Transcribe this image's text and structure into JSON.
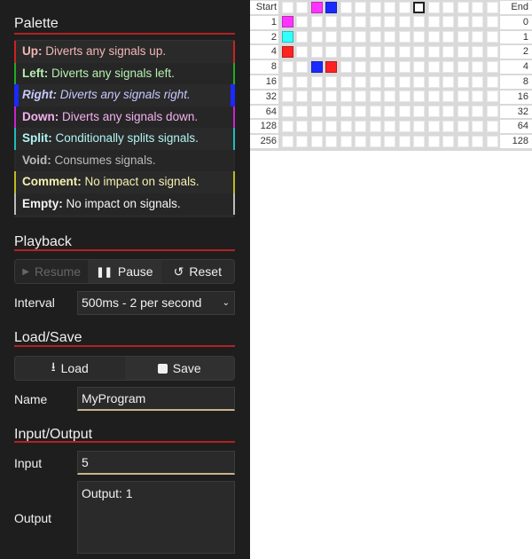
{
  "palette": {
    "title": "Palette",
    "items": [
      {
        "name": "Up",
        "desc": "Diverts any signals up.",
        "text_color": "#f4b6b6",
        "bar_color": "#cc2222",
        "selected": false
      },
      {
        "name": "Left",
        "desc": "Diverts any signals left.",
        "text_color": "#b6f0b0",
        "bar_color": "#22aa22",
        "selected": false
      },
      {
        "name": "Right",
        "desc": "Diverts any signals right.",
        "text_color": "#c8c8ff",
        "bar_color": "#1a2aff",
        "selected": true
      },
      {
        "name": "Down",
        "desc": "Diverts any signals down.",
        "text_color": "#f4b0f0",
        "bar_color": "#cc22cc",
        "selected": false
      },
      {
        "name": "Split",
        "desc": "Conditionally splits signals.",
        "text_color": "#b0f4f4",
        "bar_color": "#22bbbb",
        "selected": false
      },
      {
        "name": "Void",
        "desc": "Consumes signals.",
        "text_color": "#bbbbbb",
        "bar_color": "#2a2a2a",
        "selected": false
      },
      {
        "name": "Comment",
        "desc": "No impact on signals.",
        "text_color": "#f4f0b0",
        "bar_color": "#bbbb22",
        "selected": false
      },
      {
        "name": "Empty",
        "desc": "No impact on signals.",
        "text_color": "#f4f4f4",
        "bar_color": "#bbbbbb",
        "selected": false
      }
    ]
  },
  "playback": {
    "title": "Playback",
    "resume_label": "Resume",
    "pause_label": "Pause",
    "reset_label": "Reset",
    "interval_label": "Interval",
    "interval_value": "500ms - 2 per second"
  },
  "loadsave": {
    "title": "Load/Save",
    "load_label": "Load",
    "save_label": "Save",
    "name_label": "Name",
    "name_value": "MyProgram"
  },
  "io": {
    "title": "Input/Output",
    "input_label": "Input",
    "input_value": "5",
    "output_label": "Output",
    "output_value": "Output: 1"
  },
  "grid": {
    "columns": 15,
    "left_labels": [
      "Start",
      "1",
      "2",
      "4",
      "8",
      "16",
      "32",
      "64",
      "128",
      "256"
    ],
    "right_labels": [
      "End",
      "0",
      "1",
      "2",
      "4",
      "8",
      "16",
      "32",
      "64",
      "128"
    ],
    "selected_cell": {
      "row": 0,
      "col": 9
    },
    "filled_cells": [
      {
        "row": 0,
        "col": 2,
        "type": "Down",
        "color": "#ff33ff"
      },
      {
        "row": 0,
        "col": 3,
        "type": "Right",
        "color": "#1a2aff"
      },
      {
        "row": 1,
        "col": 0,
        "type": "Down",
        "color": "#ff33ff"
      },
      {
        "row": 2,
        "col": 0,
        "type": "Split",
        "color": "#33ffff"
      },
      {
        "row": 3,
        "col": 0,
        "type": "Up",
        "color": "#ff2222"
      },
      {
        "row": 4,
        "col": 2,
        "type": "Right",
        "color": "#1a2aff"
      },
      {
        "row": 4,
        "col": 3,
        "type": "Up",
        "color": "#ff2222"
      }
    ]
  }
}
